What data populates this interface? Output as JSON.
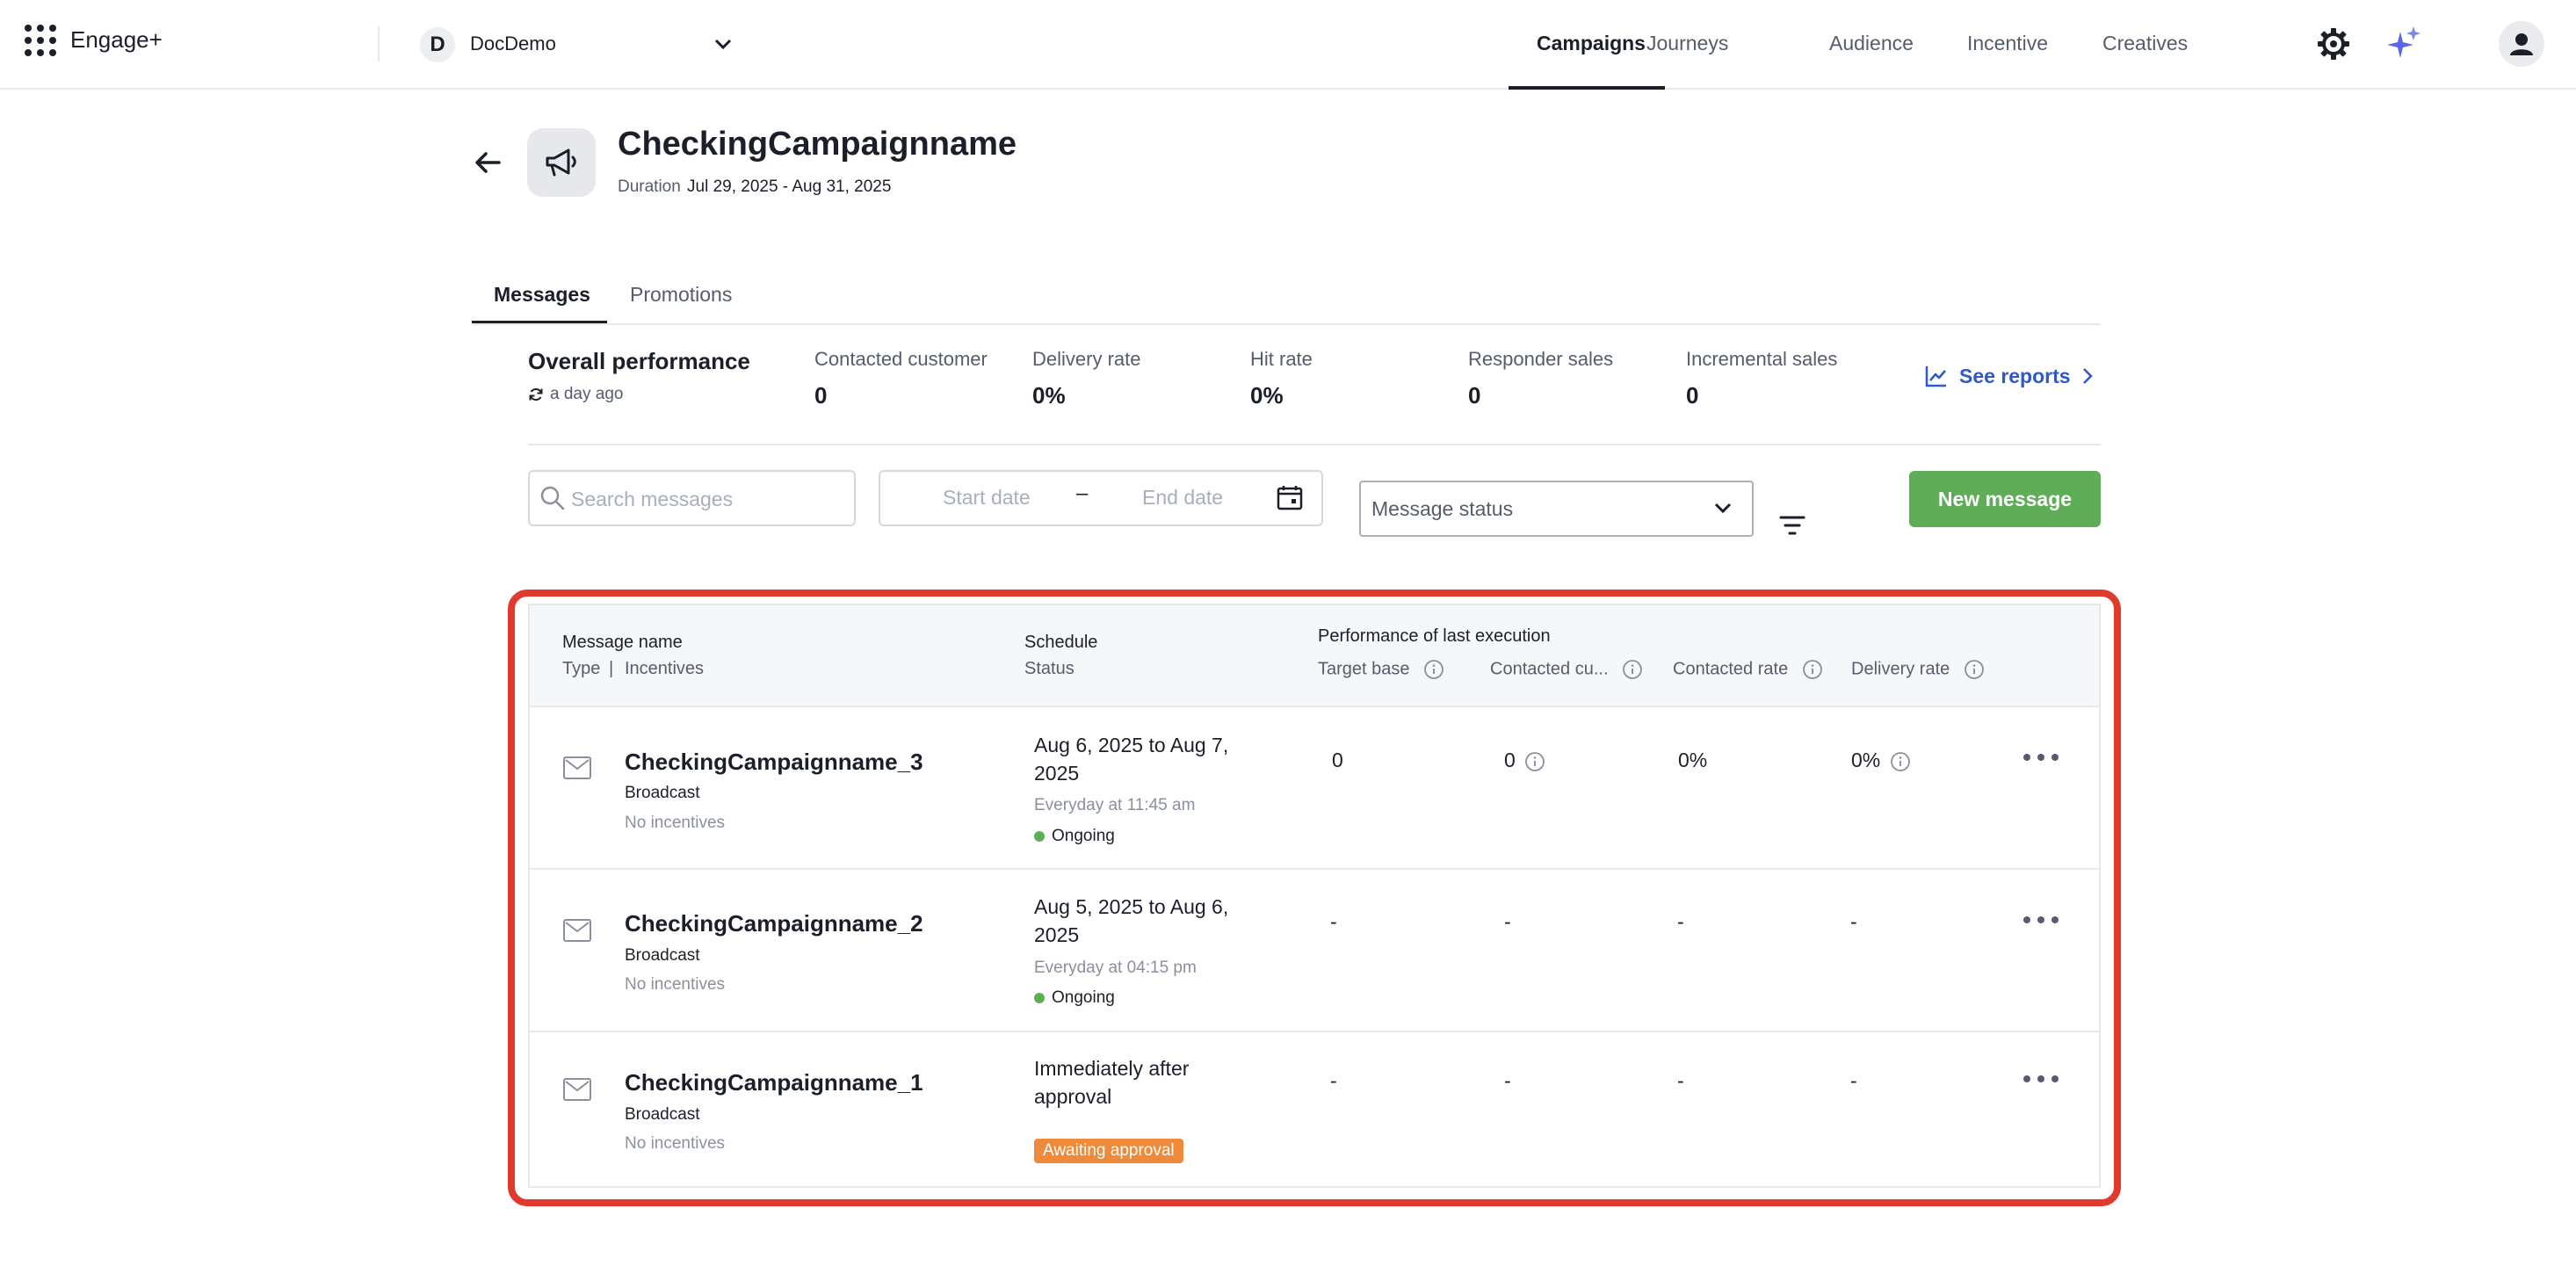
{
  "app": {
    "name": "Engage+"
  },
  "org": {
    "initial": "D",
    "name": "DocDemo"
  },
  "nav": {
    "tabs": [
      {
        "label": "Campaigns",
        "active": true
      },
      {
        "label": "Journeys"
      },
      {
        "label": "Audience"
      },
      {
        "label": "Incentive"
      },
      {
        "label": "Creatives"
      }
    ]
  },
  "campaign": {
    "title": "CheckingCampaignname",
    "duration_label": "Duration",
    "duration_value": "Jul 29, 2025 - Aug 31, 2025"
  },
  "tabs": [
    {
      "label": "Messages",
      "active": true
    },
    {
      "label": "Promotions"
    }
  ],
  "performance": {
    "title": "Overall performance",
    "updated": "a day ago",
    "kpis": [
      {
        "label": "Contacted customer",
        "value": "0"
      },
      {
        "label": "Delivery rate",
        "value": "0%"
      },
      {
        "label": "Hit rate",
        "value": "0%"
      },
      {
        "label": "Responder sales",
        "value": "0"
      },
      {
        "label": "Incremental sales",
        "value": "0"
      }
    ],
    "see_reports": "See reports"
  },
  "filters": {
    "search_placeholder": "Search messages",
    "start_date_placeholder": "Start date",
    "date_separator": "–",
    "end_date_placeholder": "End date",
    "status_placeholder": "Message status",
    "new_message": "New message"
  },
  "table": {
    "col_message_name": "Message name",
    "col_type": "Type",
    "col_sep": "|",
    "col_incentives": "Incentives",
    "col_schedule": "Schedule",
    "col_status": "Status",
    "col_performance_group": "Performance of last execution",
    "col_target_base": "Target base",
    "col_contacted_cu": "Contacted cu...",
    "col_contacted_rate": "Contacted rate",
    "col_delivery_rate": "Delivery rate",
    "rows": [
      {
        "name": "CheckingCampaignname_3",
        "type": "Broadcast",
        "incentives": "No incentives",
        "schedule": "Aug 6, 2025 to Aug 7, 2025",
        "schedule_time": "Everyday at 11:45 am",
        "status": "Ongoing",
        "target_base": "0",
        "contacted": "0",
        "contacted_rate": "0%",
        "delivery_rate": "0%"
      },
      {
        "name": "CheckingCampaignname_2",
        "type": "Broadcast",
        "incentives": "No incentives",
        "schedule": "Aug 5, 2025 to Aug 6, 2025",
        "schedule_time": "Everyday at 04:15 pm",
        "status": "Ongoing",
        "target_base": "-",
        "contacted": "-",
        "contacted_rate": "-",
        "delivery_rate": "-"
      },
      {
        "name": "CheckingCampaignname_1",
        "type": "Broadcast",
        "incentives": "No incentives",
        "schedule": "Immediately after approval",
        "status": "Awaiting approval",
        "target_base": "-",
        "contacted": "-",
        "contacted_rate": "-",
        "delivery_rate": "-"
      }
    ]
  },
  "colors": {
    "accent_blue": "#2f58cd",
    "primary_green": "#5fad56",
    "status_ongoing": "#5fad56",
    "status_awaiting": "#ee8a3a",
    "highlight_red": "#e03a2e"
  }
}
